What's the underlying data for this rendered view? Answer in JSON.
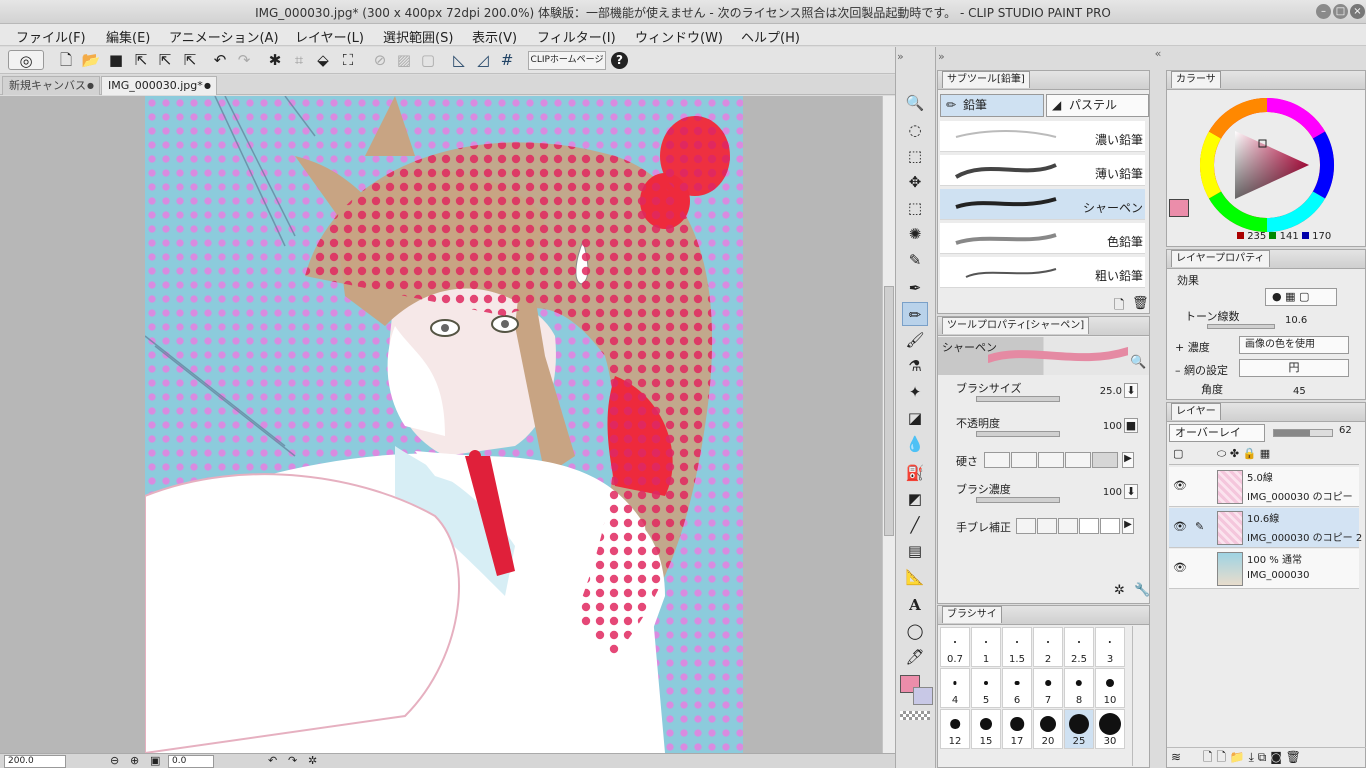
{
  "window": {
    "title": "IMG_000030.jpg* (300 x 400px 72dpi 200.0%)  体験版：一部機能が使えません - 次のライセンス照合は次回製品起動時です。 - CLIP STUDIO PAINT PRO"
  },
  "menu": [
    "ファイル(F)",
    "編集(E)",
    "アニメーション(A)",
    "レイヤー(L)",
    "選択範囲(S)",
    "表示(V)",
    "フィルター(I)",
    "ウィンドウ(W)",
    "ヘルプ(H)"
  ],
  "command_bar": {
    "clip_home_label": "CLIPホームページ",
    "help_glyph": "?"
  },
  "doc_tabs": [
    {
      "label": "新規キャンバス",
      "close": "●"
    },
    {
      "label": "IMG_000030.jpg*",
      "close": "●"
    }
  ],
  "status": {
    "zoom": "200.0",
    "rotation": "0.0"
  },
  "subtool_panel": {
    "title": "サブツール[鉛筆]",
    "tabs": [
      "鉛筆",
      "パステル"
    ],
    "brushes": [
      {
        "name": "濃い鉛筆",
        "selected": false
      },
      {
        "name": "薄い鉛筆",
        "selected": false
      },
      {
        "name": "シャーペン",
        "selected": true
      },
      {
        "name": "色鉛筆",
        "selected": false
      },
      {
        "name": "粗い鉛筆",
        "selected": false
      }
    ]
  },
  "tool_property": {
    "title": "ツールプロパティ[シャーペン]",
    "preview_label": "シャーペン",
    "brush_size": {
      "label": "ブラシサイズ",
      "value": "25.0"
    },
    "opacity": {
      "label": "不透明度",
      "value": "100"
    },
    "hardness": {
      "label": "硬さ"
    },
    "density": {
      "label": "ブラシ濃度",
      "value": "100"
    },
    "stabilization": {
      "label": "手ブレ補正"
    }
  },
  "brush_size_panel": {
    "title": "ブラシサイ",
    "sizes": [
      "0.7",
      "1",
      "1.5",
      "2",
      "2.5",
      "3",
      "4",
      "5",
      "6",
      "7",
      "8",
      "10",
      "12",
      "15",
      "17",
      "20",
      "25",
      "30"
    ],
    "selected": "25"
  },
  "color_panel": {
    "title": "カラーサ",
    "main_color": "#eb8daa",
    "sub_color": "#c8c8e6",
    "rgb": {
      "r": "235",
      "g": "141",
      "b": "170"
    }
  },
  "layer_property": {
    "title": "レイヤープロパティ",
    "effect_label": "効果",
    "tone_lines_label": "トーン線数",
    "tone_lines_value": "10.6",
    "density_label": "濃度",
    "density_value": "画像の色を使用",
    "screen_label": "網の設定",
    "screen_value": "円",
    "angle_label": "角度",
    "angle_value": "45"
  },
  "layer_panel": {
    "title": "レイヤー",
    "blend_mode": "オーバーレイ",
    "opacity": "62",
    "layers": [
      {
        "line1": "5.0線",
        "line2": "IMG_000030 のコピー",
        "selected": false
      },
      {
        "line1": "10.6線",
        "line2": "IMG_000030 のコピー 2",
        "selected": true
      },
      {
        "line1": "100 %  通常",
        "line2": "IMG_000030",
        "selected": false
      }
    ]
  }
}
